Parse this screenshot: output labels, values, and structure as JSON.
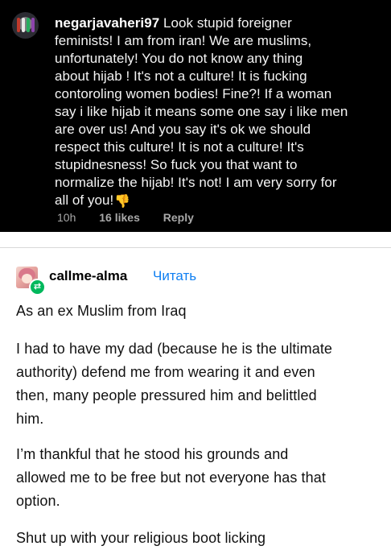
{
  "comment": {
    "username": "negarjavaheri97",
    "lines": [
      "Look stupid foreigner",
      "feminists! I am from iran! We are muslims,",
      "unfortunately! You do not know any thing",
      "about hijab ! It's not a culture! It is fucking",
      "contoroling women bodies! Fine?! If a woman",
      "say i like hijab it means some one say i like men",
      "are over us! And you say it's ok we should",
      "respect this culture! It is not a culture! It's",
      "stupidnesness! So fuck you that want to",
      "normalize the hijab! It's not!  I am very sorry for",
      "all of you!"
    ],
    "emoji": "👎",
    "time": "10h",
    "likes": "16 likes",
    "reply": "Reply"
  },
  "post": {
    "username": "callme-alma",
    "follow_label": "Читать",
    "paragraphs": [
      [
        "As an ex Muslim from Iraq"
      ],
      [
        "I had to have my dad (because he is the ultimate",
        "authority) defend me from wearing it and even",
        "then, many people pressured him and belittled",
        "him."
      ],
      [
        "I’m thankful that he stood his grounds and",
        "allowed me to be free but not everyone has that",
        "option."
      ],
      [
        "Shut up with your religious boot licking"
      ]
    ]
  },
  "icons": {
    "commenter_avatar": "avatar-image",
    "poster_avatar": "avatar-image",
    "reblog": "reblog-icon",
    "thumbs_down": "thumbs-down-emoji"
  },
  "colors": {
    "comment_background": "#000000",
    "follow_link": "#0f7ff2",
    "reblog_badge": "#00b85c"
  }
}
